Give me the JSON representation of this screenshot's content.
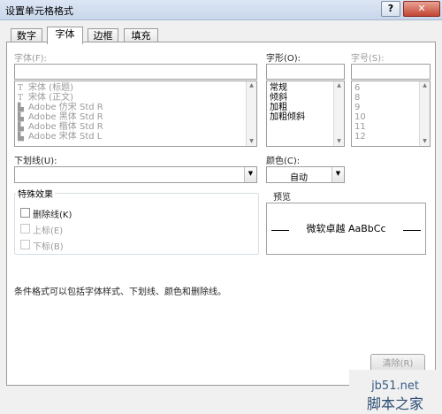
{
  "window": {
    "title": "设置单元格格式",
    "help_label": "?",
    "close_label": "✕"
  },
  "tabs": [
    {
      "label": "数字",
      "active": false
    },
    {
      "label": "字体",
      "active": true
    },
    {
      "label": "边框",
      "active": false
    },
    {
      "label": "填充",
      "active": false
    }
  ],
  "font": {
    "label": "字体(F):",
    "value": "",
    "items": [
      {
        "icon": "truetype-font-icon",
        "glyph": "T",
        "text": "宋体 (标题)"
      },
      {
        "icon": "truetype-font-icon",
        "glyph": "T",
        "text": "宋体 (正文)"
      },
      {
        "icon": "printer-font-icon",
        "glyph": "▙",
        "text": "Adobe 仿宋 Std R"
      },
      {
        "icon": "printer-font-icon",
        "glyph": "▙",
        "text": "Adobe 黑体 Std R"
      },
      {
        "icon": "printer-font-icon",
        "glyph": "▙",
        "text": "Adobe 楷体 Std R"
      },
      {
        "icon": "printer-font-icon",
        "glyph": "▙",
        "text": "Adobe 宋体 Std L"
      }
    ]
  },
  "style": {
    "label": "字形(O):",
    "value": "",
    "items": [
      "常规",
      "倾斜",
      "加粗",
      "加粗倾斜"
    ]
  },
  "size": {
    "label": "字号(S):",
    "value": "",
    "items": [
      "6",
      "8",
      "9",
      "10",
      "11",
      "12"
    ]
  },
  "underline": {
    "label": "下划线(U):",
    "value": ""
  },
  "color": {
    "label": "颜色(C):",
    "value": "自动"
  },
  "effects": {
    "title": "特殊效果",
    "items": [
      {
        "label": "删除线(K)",
        "checked": false,
        "enabled": true
      },
      {
        "label": "上标(E)",
        "checked": false,
        "enabled": false
      },
      {
        "label": "下标(B)",
        "checked": false,
        "enabled": false
      }
    ]
  },
  "preview": {
    "title": "预览",
    "text": "微软卓越  AaBbCc"
  },
  "hint": "条件格式可以包括字体样式、下划线、颜色和删除线。",
  "buttons": {
    "clear": "清除(R)"
  },
  "watermark": {
    "line1": "jb51.net",
    "line2": "脚本之家"
  },
  "colors": {
    "accent": "#3b6fb6",
    "title_bar": "#c9d7ec",
    "close": "#c24532"
  }
}
